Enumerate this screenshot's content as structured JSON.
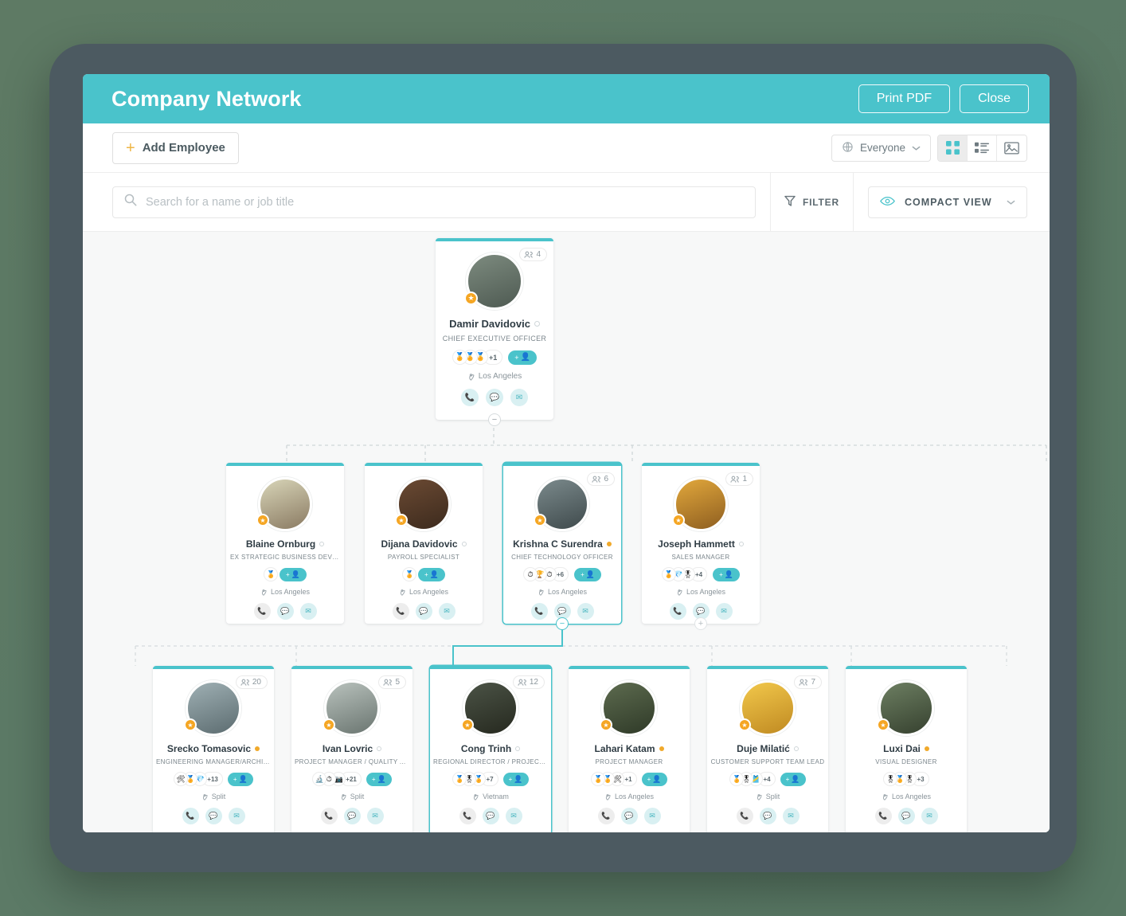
{
  "header": {
    "title": "Company Network",
    "print_label": "Print PDF",
    "close_label": "Close",
    "accent_color": "#4ac3cb"
  },
  "toolbar": {
    "add_employee_label": "Add Employee",
    "audience_label": "Everyone",
    "view_modes": [
      {
        "name": "grid-view",
        "active": true
      },
      {
        "name": "list-view",
        "active": false
      },
      {
        "name": "photo-view",
        "active": false
      }
    ]
  },
  "search": {
    "placeholder": "Search for a name or job title",
    "value": "",
    "filter_label": "FILTER",
    "compact_view_label": "COMPACT VIEW"
  },
  "chart": {
    "nodes": [
      {
        "id": "ceo",
        "name": "Damir Davidovic",
        "title": "CHIEF EXECUTIVE OFFICER",
        "location": "Los Angeles",
        "subordinate_count": "4",
        "skill_overflow": "+1",
        "skills": [
          "🏅",
          "🏅",
          "🏅"
        ],
        "status_dot": "off",
        "phone_enabled": true,
        "selected": false,
        "toggle": "minus",
        "toggle_active": false,
        "avatar_colors": [
          "#7d8b7f",
          "#4e5a52"
        ],
        "row": 1
      },
      {
        "id": "blaine",
        "name": "Blaine Ornburg",
        "title": "EX STRATEGIC BUSINESS DEVELOP...",
        "location": "Los Angeles",
        "subordinate_count": "",
        "skill_overflow": "",
        "skills": [
          "🏅"
        ],
        "status_dot": "off",
        "phone_enabled": false,
        "selected": false,
        "toggle": "",
        "toggle_active": false,
        "avatar_colors": [
          "#d8d5b8",
          "#8a7a62"
        ],
        "row": 2
      },
      {
        "id": "dijana",
        "name": "Dijana Davidovic",
        "title": "PAYROLL SPECIALIST",
        "location": "Los Angeles",
        "subordinate_count": "",
        "skill_overflow": "",
        "skills": [
          "🏅"
        ],
        "status_dot": "off",
        "phone_enabled": false,
        "selected": false,
        "toggle": "",
        "toggle_active": false,
        "avatar_colors": [
          "#6b4a33",
          "#3c2a1d"
        ],
        "row": 2
      },
      {
        "id": "krishna",
        "name": "Krishna C Surendra",
        "title": "CHIEF TECHNOLOGY OFFICER",
        "location": "Los Angeles",
        "subordinate_count": "6",
        "skill_overflow": "+6",
        "skills": [
          "⏱️",
          "🏆",
          "⏱️"
        ],
        "status_dot": "on",
        "phone_enabled": true,
        "selected": true,
        "toggle": "minus",
        "toggle_active": true,
        "avatar_colors": [
          "#7b8a8c",
          "#3f4a4c"
        ],
        "row": 2
      },
      {
        "id": "joseph",
        "name": "Joseph Hammett",
        "title": "SALES MANAGER",
        "location": "Los Angeles",
        "subordinate_count": "1",
        "skill_overflow": "+4",
        "skills": [
          "🏅",
          "💎",
          "🎖️"
        ],
        "status_dot": "off",
        "phone_enabled": true,
        "selected": false,
        "toggle": "plus",
        "toggle_active": false,
        "avatar_colors": [
          "#e2a83c",
          "#8e5e20"
        ],
        "row": 2
      },
      {
        "id": "srecko",
        "name": "Srecko Tomasovic",
        "title": "ENGINEERING MANAGER/ARCHITECT",
        "location": "Split",
        "subordinate_count": "20",
        "skill_overflow": "+13",
        "skills": [
          "🛠️",
          "🏅",
          "💎"
        ],
        "status_dot": "on",
        "phone_enabled": true,
        "selected": false,
        "toggle": "",
        "toggle_active": false,
        "avatar_colors": [
          "#9fb0b4",
          "#5c6c70"
        ],
        "row": 3
      },
      {
        "id": "ivan",
        "name": "Ivan Lovric",
        "title": "PROJECT MANAGER / QUALITY ASS...",
        "location": "Split",
        "subordinate_count": "5",
        "skill_overflow": "+21",
        "skills": [
          "🔬",
          "⏱️",
          "📷"
        ],
        "status_dot": "off",
        "phone_enabled": false,
        "selected": false,
        "toggle": "",
        "toggle_active": false,
        "avatar_colors": [
          "#b9c2bd",
          "#6a7570"
        ],
        "row": 3
      },
      {
        "id": "cong",
        "name": "Cong Trinh",
        "title": "REGIONAL DIRECTOR / PROJECT M...",
        "location": "Vietnam",
        "subordinate_count": "12",
        "skill_overflow": "+7",
        "skills": [
          "🏅",
          "🎖️",
          "🏅"
        ],
        "status_dot": "off",
        "phone_enabled": false,
        "selected": true,
        "toggle": "",
        "toggle_active": false,
        "avatar_colors": [
          "#4b5346",
          "#26291f"
        ],
        "row": 3
      },
      {
        "id": "lahari",
        "name": "Lahari Katam",
        "title": "PROJECT MANAGER",
        "location": "Los Angeles",
        "subordinate_count": "",
        "skill_overflow": "+1",
        "skills": [
          "🏅",
          "🏅",
          "🛠️"
        ],
        "status_dot": "on",
        "phone_enabled": false,
        "selected": false,
        "toggle": "",
        "toggle_active": false,
        "avatar_colors": [
          "#5d6b4f",
          "#2f3a28"
        ],
        "row": 3
      },
      {
        "id": "duje",
        "name": "Duje Milatić",
        "title": "CUSTOMER SUPPORT TEAM LEAD",
        "location": "Split",
        "subordinate_count": "7",
        "skill_overflow": "+4",
        "skills": [
          "🏅",
          "🎖️",
          "🎽"
        ],
        "status_dot": "off",
        "phone_enabled": false,
        "selected": false,
        "toggle": "",
        "toggle_active": false,
        "avatar_colors": [
          "#f2c84b",
          "#c08a22"
        ],
        "row": 3
      },
      {
        "id": "luxi",
        "name": "Luxi Dai",
        "title": "VISUAL DESIGNER",
        "location": "Los Angeles",
        "subordinate_count": "",
        "skill_overflow": "+3",
        "skills": [
          "🎖️",
          "🏅",
          "🎖️"
        ],
        "status_dot": "on",
        "phone_enabled": false,
        "selected": false,
        "toggle": "",
        "toggle_active": false,
        "avatar_colors": [
          "#6d7f62",
          "#36412f"
        ],
        "row": 3
      }
    ]
  }
}
